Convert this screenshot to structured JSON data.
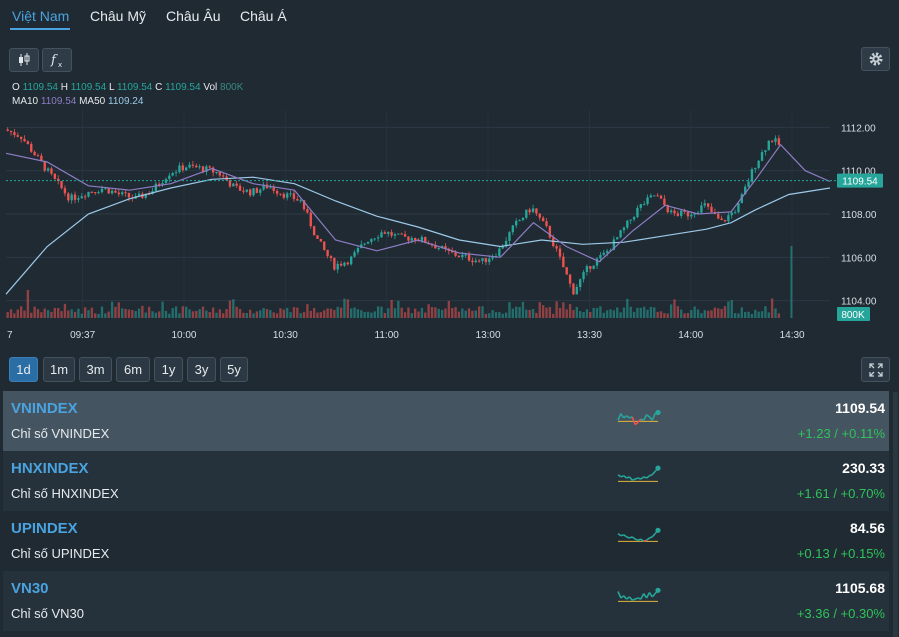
{
  "tabs": [
    {
      "label": "Việt Nam",
      "active": true
    },
    {
      "label": "Châu Mỹ",
      "active": false
    },
    {
      "label": "Châu Âu",
      "active": false
    },
    {
      "label": "Châu Á",
      "active": false
    }
  ],
  "toolbar": {
    "candle_icon": "candlestick-icon",
    "indicator_icon": "function-icon",
    "settings_icon": "gear-icon"
  },
  "legend": {
    "o_label": "O",
    "o_value": "1109.54",
    "h_label": "H",
    "h_value": "1109.54",
    "l_label": "L",
    "l_value": "1109.54",
    "c_label": "C",
    "c_value": "1109.54",
    "vol_label": "Vol",
    "vol_value": "800K",
    "ma10_label": "MA10",
    "ma10_value": "1109.54",
    "ma50_label": "MA50",
    "ma50_value": "1109.24"
  },
  "chart_data": {
    "type": "candlestick",
    "x_ticks": [
      "7",
      "09:37",
      "10:00",
      "10:30",
      "11:00",
      "13:00",
      "13:30",
      "14:00",
      "14:30"
    ],
    "y_ticks": [
      "1112.00",
      "1110.00",
      "1108.00",
      "1106.00",
      "1104.00"
    ],
    "ylim": [
      1103.2,
      1112.8
    ],
    "last_price_label": "1109.54",
    "volume_label": "800K",
    "close_path": [
      [
        0,
        1111.9
      ],
      [
        0.02,
        1111.6
      ],
      [
        0.04,
        1110.6
      ],
      [
        0.06,
        1109.6
      ],
      [
        0.08,
        1108.7
      ],
      [
        0.1,
        1109.0
      ],
      [
        0.12,
        1109.2
      ],
      [
        0.14,
        1108.9
      ],
      [
        0.16,
        1108.7
      ],
      [
        0.18,
        1109.1
      ],
      [
        0.2,
        1109.9
      ],
      [
        0.22,
        1110.2
      ],
      [
        0.24,
        1110.1
      ],
      [
        0.26,
        1109.9
      ],
      [
        0.28,
        1109.2
      ],
      [
        0.3,
        1109.0
      ],
      [
        0.32,
        1109.3
      ],
      [
        0.34,
        1108.9
      ],
      [
        0.36,
        1108.6
      ],
      [
        0.38,
        1106.8
      ],
      [
        0.4,
        1105.6
      ],
      [
        0.42,
        1105.9
      ],
      [
        0.44,
        1106.8
      ],
      [
        0.46,
        1107.2
      ],
      [
        0.48,
        1106.9
      ],
      [
        0.5,
        1106.9
      ],
      [
        0.52,
        1106.6
      ],
      [
        0.54,
        1106.2
      ],
      [
        0.56,
        1106.0
      ],
      [
        0.58,
        1105.8
      ],
      [
        0.6,
        1106.3
      ],
      [
        0.62,
        1107.5
      ],
      [
        0.64,
        1108.3
      ],
      [
        0.66,
        1107.2
      ],
      [
        0.68,
        1105.4
      ],
      [
        0.69,
        1104.4
      ],
      [
        0.71,
        1105.6
      ],
      [
        0.73,
        1106.2
      ],
      [
        0.75,
        1107.2
      ],
      [
        0.77,
        1108.3
      ],
      [
        0.79,
        1108.9
      ],
      [
        0.81,
        1108.0
      ],
      [
        0.83,
        1108.0
      ],
      [
        0.85,
        1108.4
      ],
      [
        0.87,
        1107.6
      ],
      [
        0.89,
        1108.3
      ],
      [
        0.91,
        1110.2
      ],
      [
        0.93,
        1111.5
      ],
      [
        0.94,
        1111.2
      ]
    ],
    "ma10_path": [
      [
        0,
        1110.8
      ],
      [
        0.05,
        1110.4
      ],
      [
        0.1,
        1109.3
      ],
      [
        0.15,
        1109.1
      ],
      [
        0.2,
        1109.4
      ],
      [
        0.25,
        1110.1
      ],
      [
        0.3,
        1109.4
      ],
      [
        0.35,
        1109.1
      ],
      [
        0.4,
        1106.8
      ],
      [
        0.45,
        1106.3
      ],
      [
        0.5,
        1106.8
      ],
      [
        0.55,
        1106.2
      ],
      [
        0.6,
        1106.0
      ],
      [
        0.64,
        1107.6
      ],
      [
        0.68,
        1106.5
      ],
      [
        0.72,
        1105.8
      ],
      [
        0.76,
        1107.2
      ],
      [
        0.8,
        1108.4
      ],
      [
        0.84,
        1108.0
      ],
      [
        0.88,
        1108.1
      ],
      [
        0.91,
        1109.6
      ],
      [
        0.94,
        1111.2
      ],
      [
        0.97,
        1110.0
      ],
      [
        1.0,
        1109.5
      ]
    ],
    "ma50_path": [
      [
        0,
        1104.3
      ],
      [
        0.05,
        1106.5
      ],
      [
        0.1,
        1108.0
      ],
      [
        0.15,
        1108.7
      ],
      [
        0.2,
        1109.2
      ],
      [
        0.25,
        1109.6
      ],
      [
        0.3,
        1109.7
      ],
      [
        0.35,
        1109.4
      ],
      [
        0.4,
        1108.6
      ],
      [
        0.45,
        1107.9
      ],
      [
        0.5,
        1107.4
      ],
      [
        0.55,
        1106.8
      ],
      [
        0.6,
        1106.5
      ],
      [
        0.65,
        1106.8
      ],
      [
        0.7,
        1106.6
      ],
      [
        0.75,
        1106.7
      ],
      [
        0.8,
        1107.0
      ],
      [
        0.85,
        1107.3
      ],
      [
        0.88,
        1107.6
      ],
      [
        0.91,
        1108.2
      ],
      [
        0.95,
        1108.9
      ],
      [
        1.0,
        1109.2
      ]
    ]
  },
  "ranges": [
    {
      "label": "1d",
      "active": true
    },
    {
      "label": "1m",
      "active": false
    },
    {
      "label": "3m",
      "active": false
    },
    {
      "label": "6m",
      "active": false
    },
    {
      "label": "1y",
      "active": false
    },
    {
      "label": "3y",
      "active": false
    },
    {
      "label": "5y",
      "active": false
    }
  ],
  "indices": [
    {
      "symbol": "VNINDEX",
      "name": "Chỉ số VNINDEX",
      "price": "1109.54",
      "change": "+1.23 / +0.11%",
      "spark": [
        0.6,
        0.3,
        0.5,
        0.4,
        0.5,
        0.45,
        0.8,
        0.7,
        0.55,
        0.6,
        0.35,
        0.45,
        0.6,
        0.3,
        0.25
      ]
    },
    {
      "symbol": "HNXINDEX",
      "name": "Chỉ số HNXINDEX",
      "price": "230.33",
      "change": "+1.61 / +0.70%",
      "spark": [
        0.35,
        0.45,
        0.4,
        0.5,
        0.45,
        0.6,
        0.55,
        0.5,
        0.55,
        0.45,
        0.5,
        0.4,
        0.35,
        0.2,
        0.05
      ]
    },
    {
      "symbol": "UPINDEX",
      "name": "Chỉ số UPINDEX",
      "price": "84.56",
      "change": "+0.13 / +0.15%",
      "spark": [
        0.3,
        0.4,
        0.35,
        0.45,
        0.5,
        0.45,
        0.55,
        0.6,
        0.55,
        0.65,
        0.6,
        0.5,
        0.45,
        0.3,
        0.15
      ]
    },
    {
      "symbol": "VN30",
      "name": "Chỉ số VN30",
      "price": "1105.68",
      "change": "+3.36 / +0.30%",
      "spark": [
        0.2,
        0.5,
        0.4,
        0.55,
        0.45,
        0.6,
        0.55,
        0.5,
        0.55,
        0.3,
        0.5,
        0.25,
        0.45,
        0.3,
        0.15
      ]
    }
  ],
  "colors": {
    "up": "#26a69a",
    "down": "#ef5350",
    "accent": "#4aa3df",
    "gain_text": "#2ec45a"
  }
}
